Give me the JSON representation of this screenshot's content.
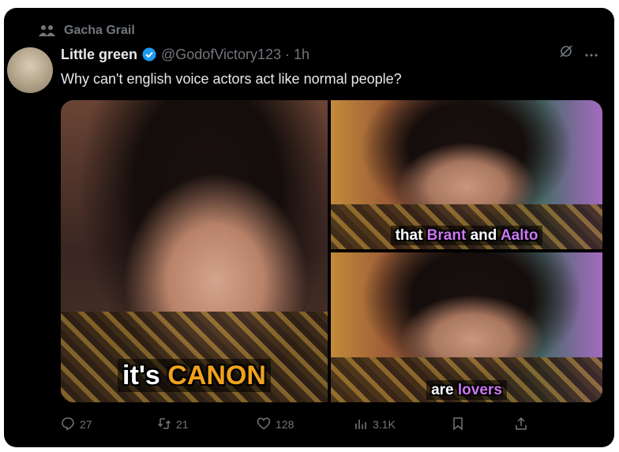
{
  "community": {
    "label": "Gacha Grail",
    "icon": "community-icon"
  },
  "post": {
    "author_name": "Little green",
    "verified_icon": "verified-badge-icon",
    "handle": "@GodofVictory123",
    "separator": "·",
    "time": "1h",
    "text": "Why can't english voice actors act like normal people?",
    "media": [
      {
        "caption_parts": [
          "it's",
          "CANON"
        ]
      },
      {
        "caption_parts": [
          "that",
          "Brant",
          "and",
          "Aalto"
        ]
      },
      {
        "caption_parts": [
          "are",
          "lovers"
        ]
      }
    ]
  },
  "actions": {
    "replies": "27",
    "reposts": "21",
    "likes": "128",
    "views": "3.1K"
  },
  "colors": {
    "background": "#000000",
    "text_primary": "#e7e9ea",
    "text_secondary": "#71767b",
    "verified": "#1d9bf0",
    "caption_orange": "#f0a21c",
    "caption_purple": "#c977f0"
  }
}
